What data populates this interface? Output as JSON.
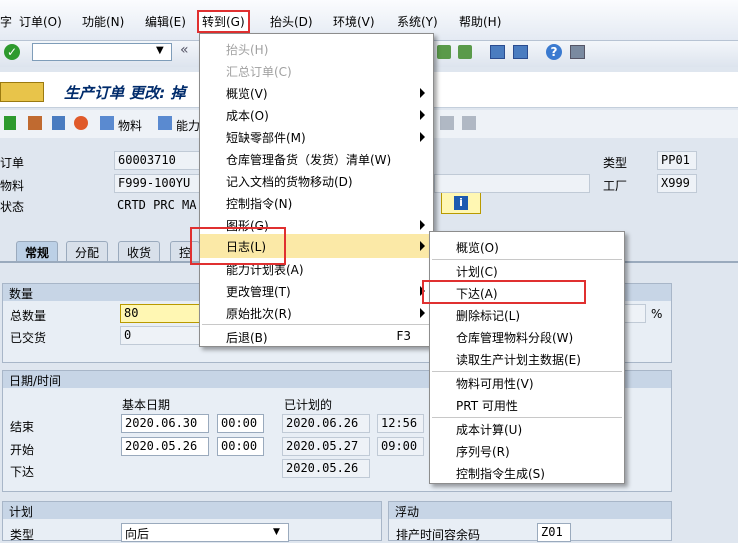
{
  "menubar": {
    "partial_left": "字",
    "items": [
      "订单(O)",
      "功能(N)",
      "编辑(E)",
      "转到(G)",
      "抬头(D)",
      "环境(V)",
      "系统(Y)",
      "帮助(H)"
    ]
  },
  "title": "生产订单 更改: 掉",
  "app_toolbar": {
    "material": "物料",
    "capacity": "能力"
  },
  "header": {
    "order_label": "订单",
    "order_value": "60003710",
    "material_label": "物料",
    "material_value": "F999-100YU",
    "status_label": "状态",
    "status_value": "CRTD PRC  MA",
    "type_label": "类型",
    "type_value": "PP01",
    "plant_label": "工厂",
    "plant_value": "X999"
  },
  "tabs": [
    "常规",
    "分配",
    "收货",
    "控"
  ],
  "quantity_group": {
    "title": "数量",
    "total_label": "总数量",
    "total_value": "80",
    "delivered_label": "已交货",
    "delivered_value": "0",
    "percent": "%"
  },
  "dates_group": {
    "title": "日期/时间",
    "col_basic": "基本日期",
    "col_sched": "已计划的",
    "rows": [
      {
        "label": "结束",
        "basic_date": "2020.06.30",
        "basic_time": "00:00",
        "sched_date": "2020.06.26",
        "sched_time": "12:56"
      },
      {
        "label": "开始",
        "basic_date": "2020.05.26",
        "basic_time": "00:00",
        "sched_date": "2020.05.27",
        "sched_time": "09:00"
      },
      {
        "label": "下达",
        "basic_date": "",
        "basic_time": "",
        "sched_date": "2020.05.26",
        "sched_time": ""
      }
    ]
  },
  "plan_group": {
    "title": "计划",
    "type_label": "类型",
    "type_value": "向后"
  },
  "float_group": {
    "title": "浮动",
    "key_label": "排产时间容余码",
    "key_value": "Z01"
  },
  "goto_menu": {
    "items": [
      {
        "label": "抬头(H)",
        "disabled": true,
        "arrow": false,
        "shortcut": ""
      },
      {
        "label": "汇总订单(C)",
        "disabled": true,
        "arrow": false,
        "shortcut": ""
      },
      {
        "label": "概览(V)",
        "disabled": false,
        "arrow": true,
        "shortcut": ""
      },
      {
        "label": "成本(O)",
        "disabled": false,
        "arrow": true,
        "shortcut": ""
      },
      {
        "label": "短缺零部件(M)",
        "disabled": false,
        "arrow": true,
        "shortcut": ""
      },
      {
        "label": "仓库管理备货（发货）清单(W)",
        "disabled": false,
        "arrow": false,
        "shortcut": ""
      },
      {
        "label": "记入文档的货物移动(D)",
        "disabled": false,
        "arrow": false,
        "shortcut": ""
      },
      {
        "label": "控制指令(N)",
        "disabled": false,
        "arrow": false,
        "shortcut": ""
      },
      {
        "label": "图形(G)",
        "disabled": false,
        "arrow": true,
        "shortcut": ""
      },
      {
        "label": "日志(L)",
        "disabled": false,
        "arrow": true,
        "shortcut": ""
      },
      {
        "label": "能力计划表(A)",
        "disabled": false,
        "arrow": false,
        "shortcut": ""
      },
      {
        "label": "更改管理(T)",
        "disabled": false,
        "arrow": true,
        "shortcut": ""
      },
      {
        "label": "原始批次(R)",
        "disabled": false,
        "arrow": true,
        "shortcut": ""
      },
      {
        "label": "后退(B)",
        "disabled": false,
        "arrow": false,
        "shortcut": "F3"
      }
    ]
  },
  "log_submenu": {
    "items": [
      "概览(O)",
      "计划(C)",
      "下达(A)",
      "删除标记(L)",
      "仓库管理物料分段(W)",
      "读取生产计划主数据(E)",
      "物料可用性(V)",
      "PRT 可用性",
      "成本计算(U)",
      "序列号(R)",
      "控制指令生成(S)"
    ]
  },
  "colors": {
    "highlight": "#e03030",
    "hover": "#fbe9a7",
    "title_blue": "#002b6b"
  }
}
